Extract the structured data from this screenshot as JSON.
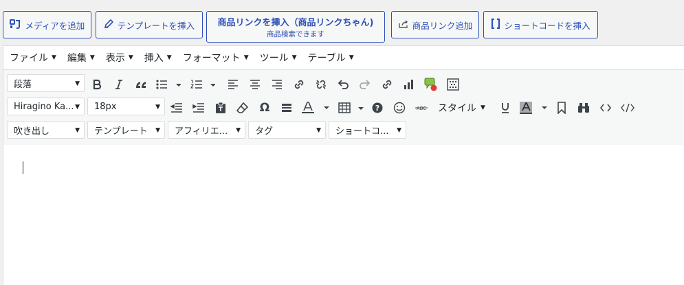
{
  "media_buttons": {
    "add_media": "メディアを追加",
    "template_insert": "テンプレートを挿入",
    "product_link": "商品リンクを挿入（商品リンクちゃん)",
    "product_link_sub": "商品検索できます",
    "product_link_add": "商品リンク追加",
    "shortcode_insert": "ショートコードを挿入"
  },
  "menubar": [
    "ファイル",
    "編集",
    "表示",
    "挿入",
    "フォーマット",
    "ツール",
    "テーブル"
  ],
  "toolbar1": {
    "format_select": "段落"
  },
  "toolbar2": {
    "font_family": "Hiragino Ka...",
    "font_size": "18px",
    "style_label": "スタイル"
  },
  "toolbar3": {
    "balloon": "吹き出し",
    "template": "テンプレート",
    "affiliate": "アフィリエ...",
    "tag": "タグ",
    "shortcode": "ショートコ..."
  },
  "colors": {
    "accent": "#2c4fb8",
    "toolbar_bg": "#f6f7f7",
    "border": "#dcdcde"
  }
}
